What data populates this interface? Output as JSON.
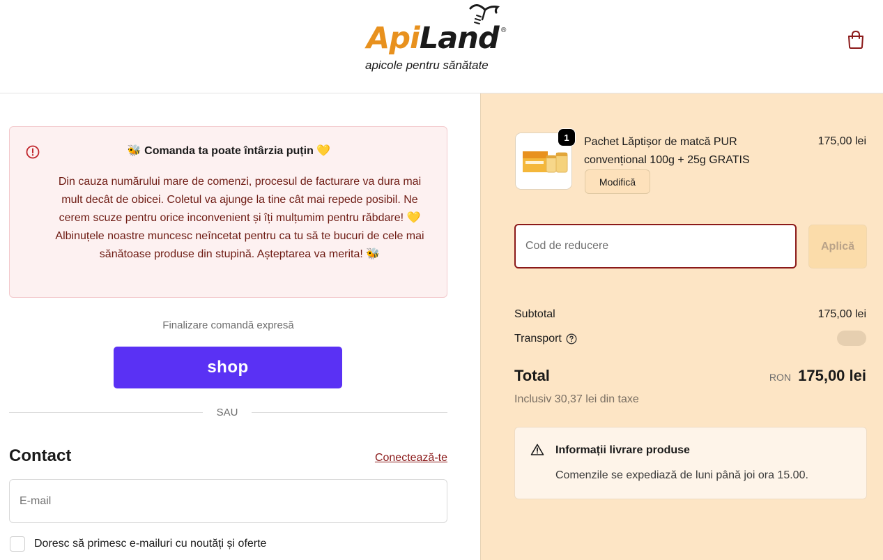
{
  "header": {
    "logo_api": "Api",
    "logo_land": "Land",
    "logo_reg": "®",
    "logo_tagline": "apicole pentru sănătate",
    "cart_icon": "shopping-bag-icon"
  },
  "notice": {
    "icon": "alert-circle-icon",
    "title": "🐝 Comanda ta poate întârzia puțin 💛",
    "body": "Din cauza numărului mare de comenzi, procesul de facturare va dura mai mult decât de obicei. Coletul va ajunge la tine cât mai repede posibil. Ne cerem scuze pentru orice inconvenient și îți mulțumim pentru răbdare! 💛 Albinuțele noastre muncesc neîncetat pentru ca tu să te bucuri de cele mai sănătoase produse din stupină. Așteptarea va merita! 🐝"
  },
  "express": {
    "label": "Finalizare comandă expresă",
    "shop_button": "shop",
    "or": "SAU"
  },
  "contact": {
    "title": "Contact",
    "login_link": "Conectează-te",
    "email_placeholder": "E-mail",
    "newsletter_label": "Doresc să primesc e-mailuri cu noutăți și oferte"
  },
  "cart": {
    "item": {
      "quantity": "1",
      "name": "Pachet Lăptișor de matcă PUR convențional 100g + 25g GRATIS",
      "price": "175,00 lei",
      "modify": "Modifică"
    },
    "discount_placeholder": "Cod de reducere",
    "apply_button": "Aplică",
    "subtotal_label": "Subtotal",
    "subtotal_value": "175,00 lei",
    "transport_label": "Transport",
    "total_label": "Total",
    "total_currency": "RON",
    "total_value": "175,00 lei",
    "tax_note": "Inclusiv 30,37 lei din taxe"
  },
  "delivery_info": {
    "icon": "warning-triangle-icon",
    "title": "Informații livrare produse",
    "text": "Comenzile se expediază de luni până joi ora 15.00."
  },
  "colors": {
    "brand_orange": "#e8911e",
    "accent_red": "#8b1a1a",
    "shop_purple": "#5a31f4",
    "sidebar_bg": "#fde5c5"
  }
}
